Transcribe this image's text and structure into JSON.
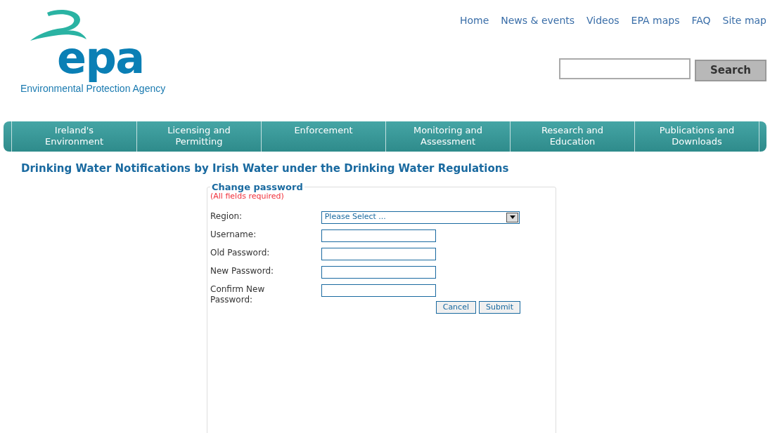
{
  "logo": {
    "wordmark": "epa",
    "caption": "Environmental Protection Agency"
  },
  "top_links": [
    "Home",
    "News & events",
    "Videos",
    "EPA maps",
    "FAQ",
    "Site map"
  ],
  "search": {
    "button": "Search"
  },
  "nav": [
    {
      "label": "Ireland's\nEnvironment"
    },
    {
      "label": "Licensing and\nPermitting"
    },
    {
      "label": "Enforcement"
    },
    {
      "label": "Monitoring and\nAssessment"
    },
    {
      "label": "Research and\nEducation"
    },
    {
      "label": "Publications and\nDownloads"
    }
  ],
  "page_title": "Drinking Water Notifications by Irish Water under the Drinking Water Regulations",
  "form": {
    "legend": "Change password",
    "note": "(All fields required)",
    "fields": [
      {
        "kind": "select",
        "label": "Region:",
        "value": "Please Select ..."
      },
      {
        "kind": "text",
        "label": "Username:"
      },
      {
        "kind": "text",
        "label": "Old Password:"
      },
      {
        "kind": "text",
        "label": "New Password:"
      },
      {
        "kind": "text",
        "label": "Confirm New Password:"
      }
    ],
    "buttons": [
      "Cancel",
      "Submit"
    ]
  }
}
